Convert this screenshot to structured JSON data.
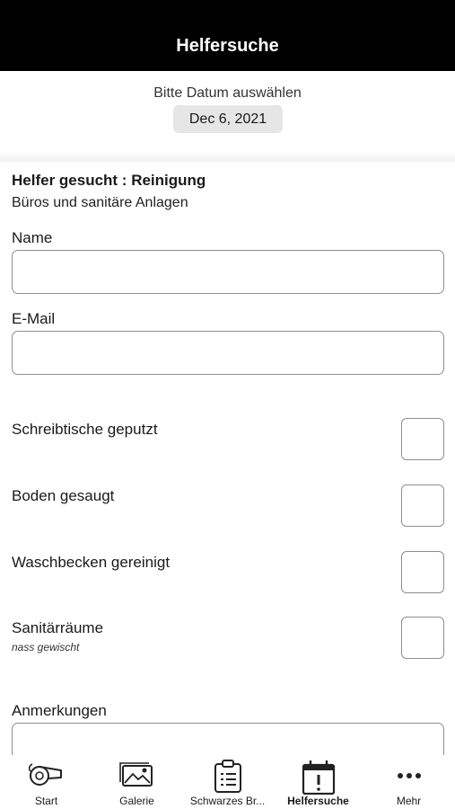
{
  "header": {
    "title": "Helfersuche"
  },
  "date": {
    "prompt": "Bitte Datum auswählen",
    "value": "Dec 6, 2021"
  },
  "form": {
    "title": "Helfer gesucht : Reinigung",
    "subtitle": "Büros und sanitäre Anlagen",
    "name_label": "Name",
    "name_value": "",
    "email_label": "E-Mail",
    "email_value": "",
    "checks": [
      {
        "label": "Schreibtische geputzt",
        "sub": "",
        "checked": false
      },
      {
        "label": "Boden gesaugt",
        "sub": "",
        "checked": false
      },
      {
        "label": "Waschbecken gereinigt",
        "sub": "",
        "checked": false
      },
      {
        "label": "Sanitärräume",
        "sub": "nass gewischt",
        "checked": false
      }
    ],
    "notes_label": "Anmerkungen"
  },
  "tabs": [
    {
      "label": "Start",
      "icon": "whistle-icon",
      "active": false
    },
    {
      "label": "Galerie",
      "icon": "gallery-icon",
      "active": false
    },
    {
      "label": "Schwarzes Br...",
      "icon": "clipboard-icon",
      "active": false
    },
    {
      "label": "Helfersuche",
      "icon": "calendar-alert-icon",
      "active": true
    },
    {
      "label": "Mehr",
      "icon": "more-icon",
      "active": false
    }
  ],
  "colors": {
    "nav_background": "#000000",
    "field_border": "#8e8e93",
    "date_pill": "#e6e6e6"
  }
}
